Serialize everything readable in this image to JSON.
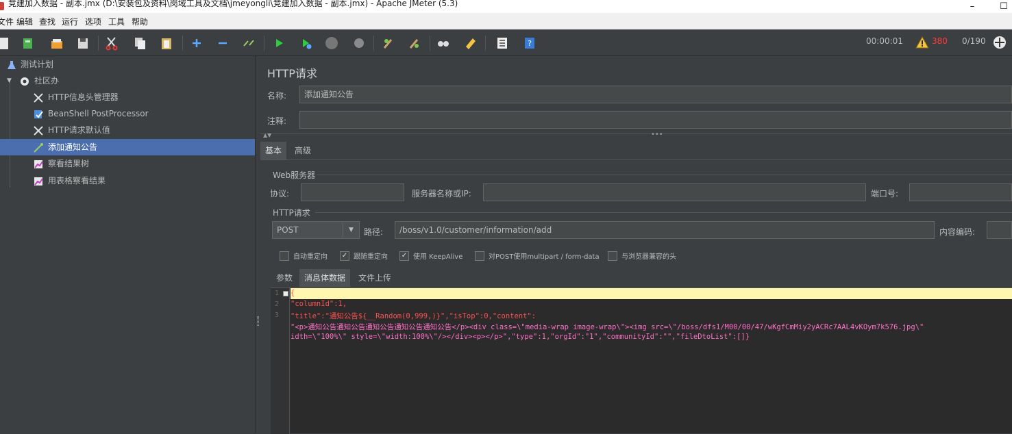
{
  "window": {
    "title": "竞建加入数据 - 副本.jmx (D:\\安装包及资料\\岗域工具及文档\\jmeyongli\\竞建加入数据 - 副本.jmx) - Apache JMeter (5.3)",
    "minimize": "–",
    "maximize": "☐"
  },
  "menu": [
    "文件",
    "编辑",
    "查找",
    "运行",
    "选项",
    "工具",
    "帮助"
  ],
  "toolbar": {
    "elapsed": "00:00:01",
    "warning_count": "380",
    "threads": "0/190"
  },
  "tree": {
    "items": [
      {
        "label": "测试计划",
        "icon": "flask-icon"
      },
      {
        "label": "社区办",
        "icon": "gear-icon"
      },
      {
        "label": "HTTP信息头管理器",
        "icon": "wrench-icon"
      },
      {
        "label": "BeanShell PostProcessor",
        "icon": "script-icon"
      },
      {
        "label": "HTTP请求默认值",
        "icon": "wrench-icon"
      },
      {
        "label": "添加通知公告",
        "icon": "pipette-icon"
      },
      {
        "label": "察看结果树",
        "icon": "chart-icon"
      },
      {
        "label": "用表格察看结果",
        "icon": "chart-icon"
      }
    ]
  },
  "sampler": {
    "title": "HTTP请求",
    "name_label": "名称:",
    "name_value": "添加通知公告",
    "comment_label": "注释:",
    "comment_value": "",
    "tabs": [
      "基本",
      "高级"
    ],
    "web_server": {
      "group": "Web服务器",
      "protocol_label": "协议:",
      "protocol_value": "",
      "server_label": "服务器名称或IP:",
      "server_value": "",
      "port_label": "端口号:",
      "port_value": ""
    },
    "http_request": {
      "group": "HTTP请求",
      "method": "POST",
      "path_label": "路径:",
      "path_value": "/boss/v1.0/customer/information/add",
      "encoding_label": "内容编码:",
      "encoding_value": ""
    },
    "checkboxes": [
      {
        "label": "自动重定向",
        "checked": false
      },
      {
        "label": "跟随重定向",
        "checked": true
      },
      {
        "label": "使用 KeepAlive",
        "checked": true
      },
      {
        "label": "对POST使用multipart / form-data",
        "checked": false
      },
      {
        "label": "与浏览器兼容的头",
        "checked": false
      }
    ],
    "body_tabs": [
      "参数",
      "消息体数据",
      "文件上传"
    ],
    "body_lines": [
      "{",
      "\"columnId\":1,",
      "\"title\":\"通知公告${__Random(0,999,)}\",\"isTop\":0,\"content\":",
      "\"<p>通知公告通知公告通知公告通知公告通知公告</p><div class=\\\"media-wrap image-wrap\\\"><img src=\\\"/boss/dfs1/M00/00/47/wKgfCmMiy2yACRc7AAL4vKOym7k576.jpg\\\"",
      "idth=\\\"100%\\\" style=\\\"width:100%\\\"/></div><p></p>\",\"type\":1,\"orgId\":\"1\",\"communityId\":\"\",\"fileDtoList\":[]}"
    ],
    "line_numbers": [
      "1",
      "2",
      "3"
    ]
  }
}
